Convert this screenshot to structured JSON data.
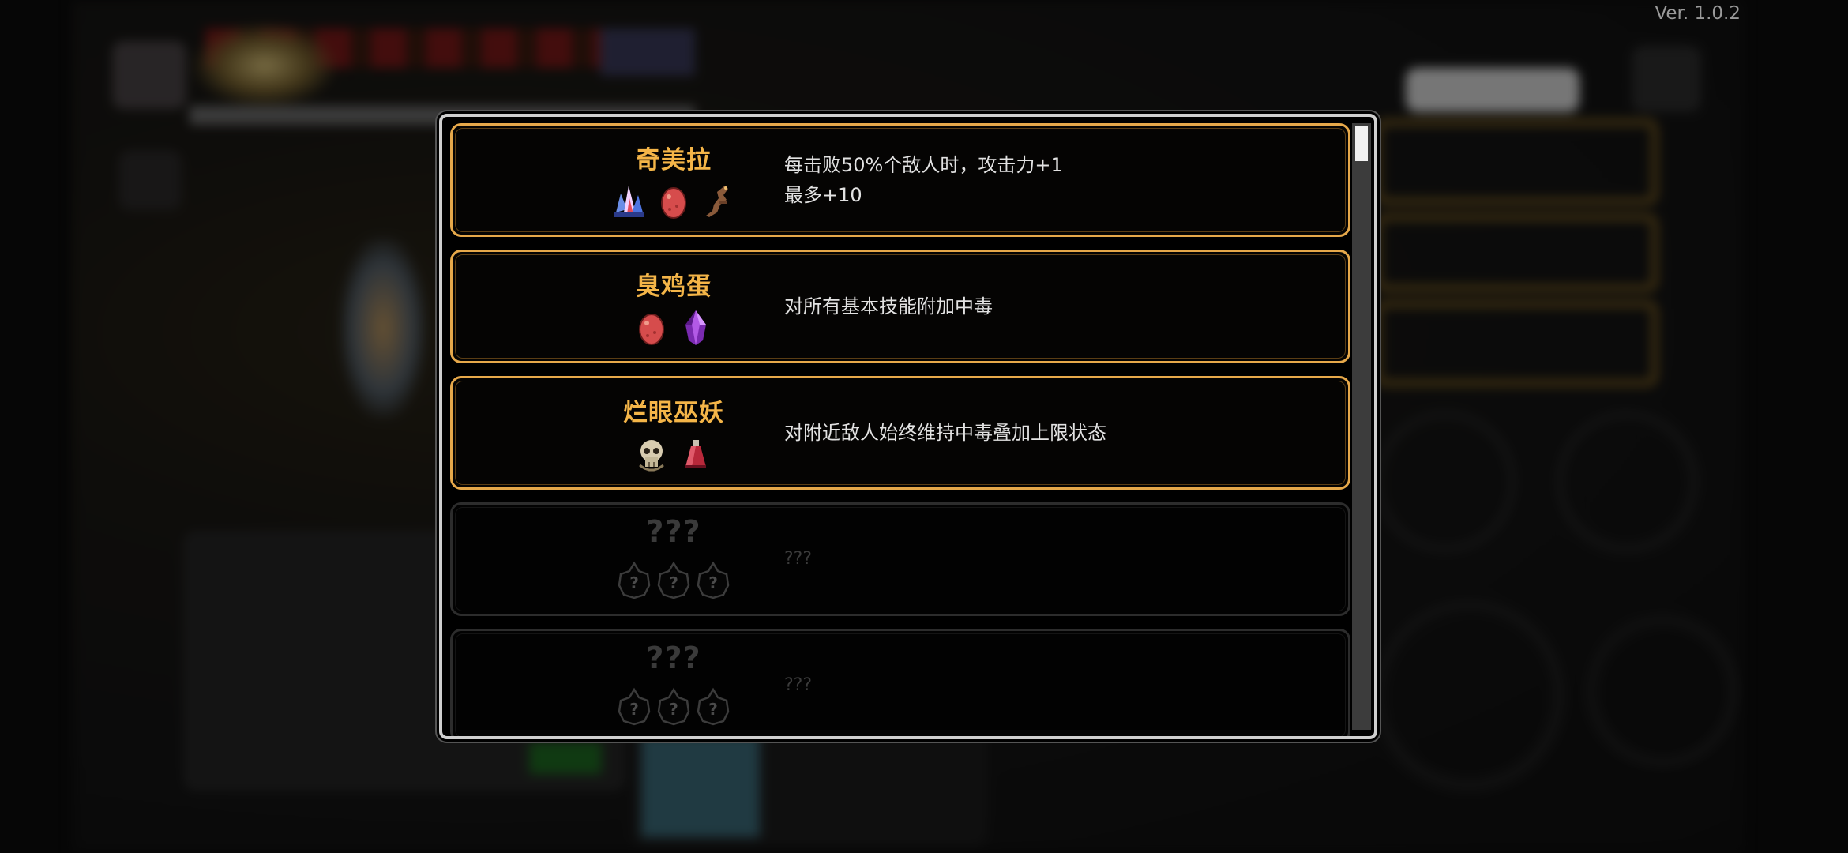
{
  "version": "Ver. 1.0.2",
  "codex": {
    "entries": [
      {
        "title": "奇美拉",
        "desc_lines": [
          "每击败50%个敌人时，攻击力+1",
          "最多+10"
        ],
        "icons": [
          "crystal-cluster-icon",
          "red-egg-icon",
          "lizard-tail-icon"
        ],
        "unlocked": true
      },
      {
        "title": "臭鸡蛋",
        "desc_lines": [
          "对所有基本技能附加中毒"
        ],
        "icons": [
          "red-egg-icon",
          "purple-gem-icon"
        ],
        "unlocked": true
      },
      {
        "title": "烂眼巫妖",
        "desc_lines": [
          "对附近敌人始终维持中毒叠加上限状态"
        ],
        "icons": [
          "skull-icon",
          "red-potion-icon"
        ],
        "unlocked": true
      },
      {
        "title": "???",
        "desc_lines": [
          "???"
        ],
        "icons": [
          "unknown-item-icon",
          "unknown-item-icon",
          "unknown-item-icon"
        ],
        "unlocked": false
      },
      {
        "title": "???",
        "desc_lines": [
          "???"
        ],
        "icons": [
          "unknown-item-icon",
          "unknown-item-icon",
          "unknown-item-icon"
        ],
        "unlocked": false
      }
    ]
  },
  "colors": {
    "title_gold": "#f4b548",
    "frame_gold": "#e6a84a",
    "text": "#e2e2e2",
    "locked": "#3b3b3b"
  }
}
